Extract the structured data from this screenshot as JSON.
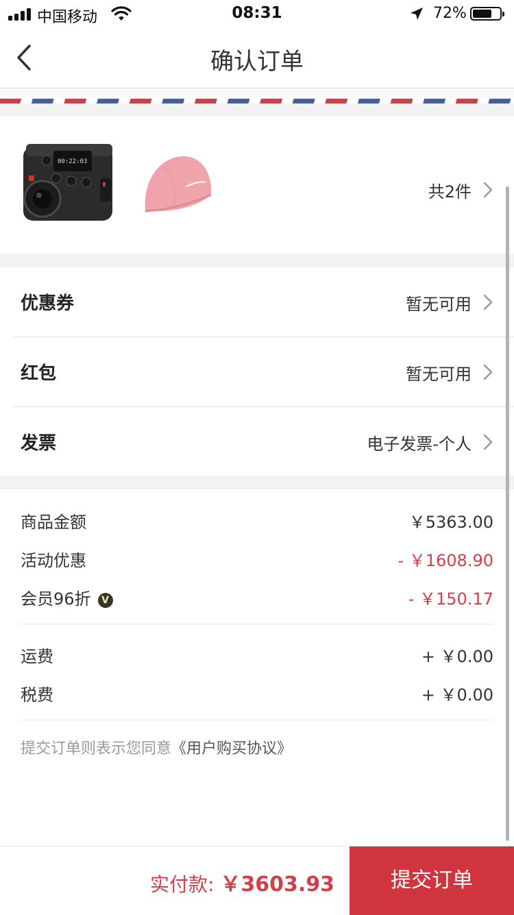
{
  "status_bar": {
    "carrier": "中国移动",
    "time": "08:31",
    "battery_percent": "72%",
    "battery_level": 0.72
  },
  "nav": {
    "title": "确认订单"
  },
  "products": {
    "count_label": "共2件",
    "items": [
      {
        "icon": "action-camera-image"
      },
      {
        "icon": "swim-cap-image"
      }
    ]
  },
  "options": {
    "coupon": {
      "label": "优惠券",
      "value": "暂无可用"
    },
    "red_packet": {
      "label": "红包",
      "value": "暂无可用"
    },
    "invoice": {
      "label": "发票",
      "value": "电子发票-个人"
    }
  },
  "amounts": {
    "goods": {
      "label": "商品金额",
      "value": "￥5363.00"
    },
    "promotion": {
      "label": "活动优惠",
      "value": "- ￥1608.90"
    },
    "member": {
      "label": "会员96折",
      "badge": "V",
      "value": "- ￥150.17"
    },
    "shipping": {
      "label": "运费",
      "value": "+ ￥0.00"
    },
    "tax": {
      "label": "税费",
      "value": "+ ￥0.00"
    }
  },
  "agreement": {
    "text": "提交订单则表示您同意",
    "link": "《用户购买协议》"
  },
  "footer": {
    "pay_label": "实付款: ",
    "pay_amount": "￥3603.93",
    "submit_label": "提交订单"
  },
  "colors": {
    "accent_red": "#d0353f",
    "price_red": "#d0404a",
    "airmail_red": "#c1454f",
    "airmail_blue": "#4c5f91"
  }
}
